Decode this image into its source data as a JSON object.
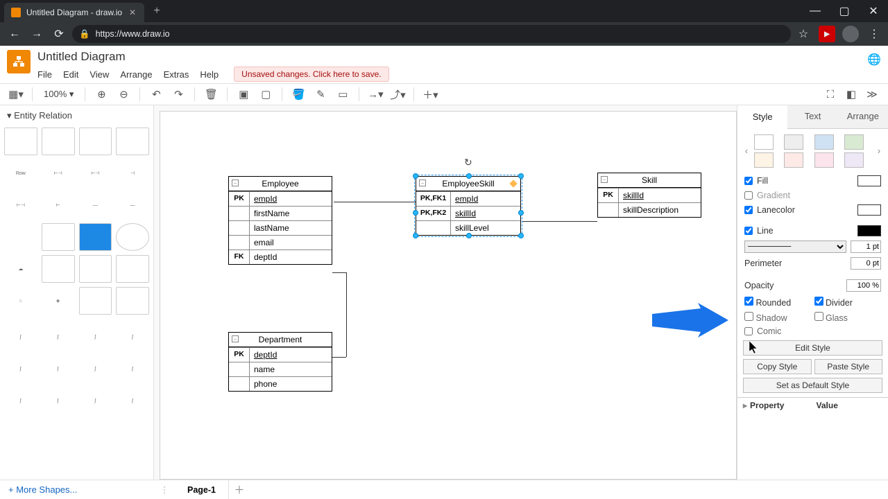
{
  "browser": {
    "tab_title": "Untitled Diagram - draw.io",
    "url": "https://www.draw.io"
  },
  "app": {
    "title": "Untitled Diagram",
    "menus": [
      "File",
      "Edit",
      "View",
      "Arrange",
      "Extras",
      "Help"
    ],
    "unsaved_msg": "Unsaved changes. Click here to save."
  },
  "toolbar": {
    "zoom": "100%"
  },
  "sidebar": {
    "category": "Entity Relation",
    "row_label": "Row",
    "more_shapes": "+ More Shapes..."
  },
  "entities": {
    "employee": {
      "title": "Employee",
      "rows": [
        {
          "key": "PK",
          "val": "empId",
          "underline": true
        },
        {
          "key": "",
          "val": "firstName"
        },
        {
          "key": "",
          "val": "lastName"
        },
        {
          "key": "",
          "val": "email"
        },
        {
          "key": "FK",
          "val": "deptId"
        }
      ]
    },
    "employeeSkill": {
      "title": "EmployeeSkill",
      "rows": [
        {
          "key": "PK,FK1",
          "val": "empId",
          "underline": true
        },
        {
          "key": "PK,FK2",
          "val": "skillId",
          "underline": true
        },
        {
          "key": "",
          "val": "skillLevel"
        }
      ]
    },
    "skill": {
      "title": "Skill",
      "rows": [
        {
          "key": "PK",
          "val": "skillId",
          "underline": true
        },
        {
          "key": "",
          "val": "skillDescription"
        }
      ]
    },
    "department": {
      "title": "Department",
      "rows": [
        {
          "key": "PK",
          "val": "deptId",
          "underline": true
        },
        {
          "key": "",
          "val": "name"
        },
        {
          "key": "",
          "val": "phone"
        }
      ]
    }
  },
  "props": {
    "tabs": [
      "Style",
      "Text",
      "Arrange"
    ],
    "fill": {
      "label": "Fill",
      "checked": true,
      "color": "#ffffff"
    },
    "gradient": {
      "label": "Gradient",
      "checked": false
    },
    "lanecolor": {
      "label": "Lanecolor",
      "checked": true,
      "color": "#ffffff"
    },
    "line": {
      "label": "Line",
      "checked": true,
      "color": "#000000",
      "width": "1 pt"
    },
    "perimeter": {
      "label": "Perimeter",
      "value": "0 pt"
    },
    "opacity": {
      "label": "Opacity",
      "value": "100 %"
    },
    "rounded": {
      "label": "Rounded",
      "checked": true
    },
    "divider": {
      "label": "Divider",
      "checked": true
    },
    "shadow": {
      "label": "Shadow",
      "checked": false
    },
    "glass": {
      "label": "Glass",
      "checked": false
    },
    "comic": {
      "label": "Comic",
      "checked": false
    },
    "edit_style": "Edit Style",
    "copy_style": "Copy Style",
    "paste_style": "Paste Style",
    "default_style": "Set as Default Style",
    "property": "Property",
    "value": "Value"
  },
  "swatches": [
    "#ffffff",
    "#eeeeee",
    "#cfe2f3",
    "#d9ead3",
    "#fef4e5",
    "#fdecea",
    "#fde9e6",
    "#ede7f6"
  ],
  "bottom": {
    "page": "Page-1"
  }
}
